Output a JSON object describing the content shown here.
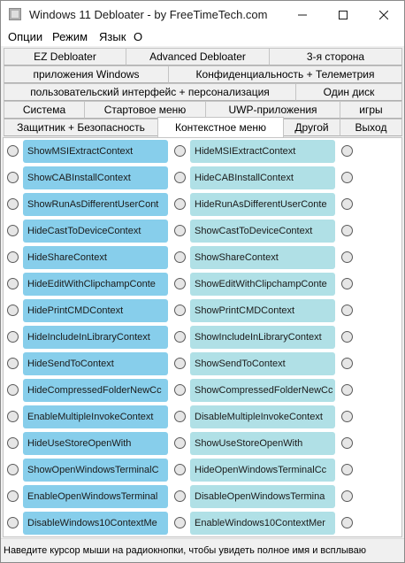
{
  "window": {
    "title": "Windows 11 Debloater - by FreeTimeTech.com",
    "controls": [
      "minimize-icon",
      "maximize-icon",
      "close-icon"
    ]
  },
  "menubar": {
    "items": [
      "Опции",
      "Режим",
      "Язык",
      "О"
    ]
  },
  "tabs": {
    "rows": [
      [
        "EZ Debloater",
        "Advanced Debloater",
        "3-я сторона"
      ],
      [
        "приложения Windows",
        "Конфиденциальность + Телеметрия"
      ],
      [
        "пользовательский интерфейс + персонализация",
        "Один диск"
      ],
      [
        "Система",
        "Стартовое меню",
        "UWP-приложения",
        "игры"
      ],
      [
        "Защитник + Безопасность",
        "Контекстное меню",
        "Другой",
        "Выход"
      ]
    ],
    "active": "Контекстное меню"
  },
  "options": {
    "left": [
      "ShowMSIExtractContext",
      "ShowCABInstallContext",
      "ShowRunAsDifferentUserCont",
      "HideCastToDeviceContext",
      "HideShareContext",
      "HideEditWithClipchampConte",
      "HidePrintCMDContext",
      "HideIncludeInLibraryContext",
      "HideSendToContext",
      "HideCompressedFolderNewCc",
      "EnableMultipleInvokeContext",
      "HideUseStoreOpenWith",
      "ShowOpenWindowsTerminalC",
      "EnableOpenWindowsTerminal",
      "DisableWindows10ContextMe"
    ],
    "right": [
      "HideMSIExtractContext",
      "HideCABInstallContext",
      "HideRunAsDifferentUserConte",
      "ShowCastToDeviceContext",
      "ShowShareContext",
      "ShowEditWithClipchampConte",
      "ShowPrintCMDContext",
      "ShowIncludeInLibraryContext",
      "ShowSendToContext",
      "ShowCompressedFolderNewCc",
      "DisableMultipleInvokeContext",
      "ShowUseStoreOpenWith",
      "HideOpenWindowsTerminalCc",
      "DisableOpenWindowsTermina",
      "EnableWindows10ContextMer"
    ]
  },
  "colors": {
    "left_pill": "#87ceeb",
    "right_pill": "#b0e0e6"
  },
  "status": {
    "text": "Наведите курсор мыши на радиокнопки, чтобы увидеть полное имя и всплываю"
  }
}
